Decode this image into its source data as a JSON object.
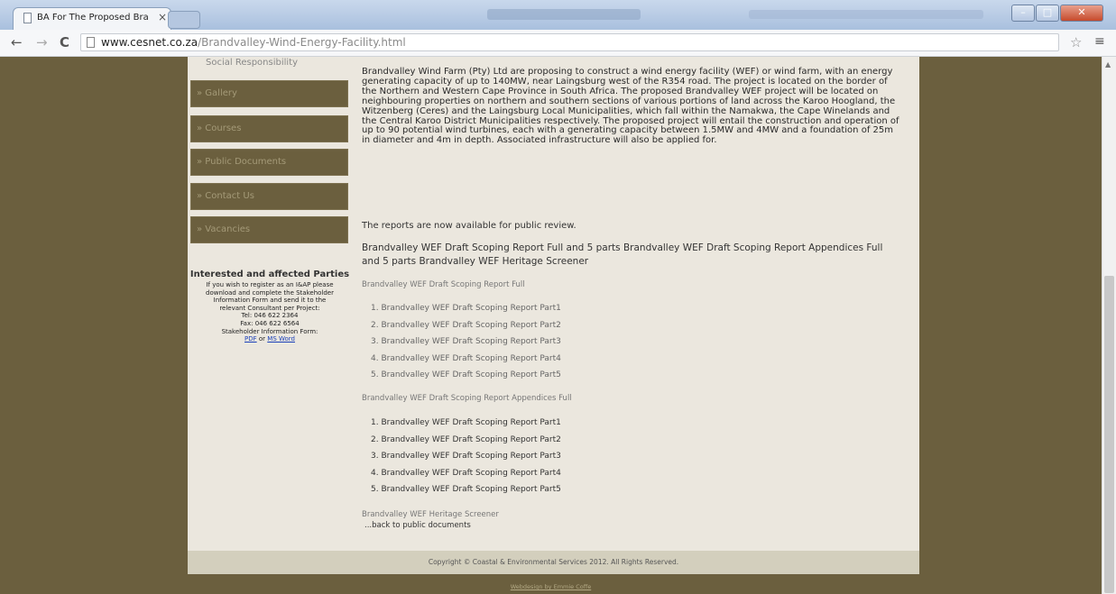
{
  "browser": {
    "tab_title": "BA For The Proposed Bra",
    "tab_close": "×",
    "url_host": "www.cesnet.co.za",
    "url_path": "/Brandvalley-Wind-Energy-Facility.html",
    "back": "←",
    "forward": "→",
    "reload": "C",
    "star": "☆",
    "menu": "≡"
  },
  "sidebar": {
    "top_label": "Social Responsibility",
    "items": [
      {
        "label": "» Gallery"
      },
      {
        "label": "» Courses"
      },
      {
        "label": "» Public Documents"
      },
      {
        "label": "» Contact Us"
      },
      {
        "label": "» Vacancies"
      }
    ],
    "iap": {
      "title": "Interested and affected Parties",
      "lines": [
        "If you wish to register as an I&AP please",
        "download and complete the Stakeholder",
        "Information Form and send it to the",
        "relevant Consultant per Project:",
        "Tel: 046 622 2364",
        "Fax: 046 622 6564",
        "Stakeholder Information Form:"
      ],
      "link_pdf": "PDF",
      "link_or": "or",
      "link_word": "MS Word"
    }
  },
  "content": {
    "intro": "Brandvalley Wind Farm (Pty) Ltd are proposing to construct a wind energy facility (WEF) or wind farm, with an energy generating capacity of up to 140MW, near Laingsburg west of the R354 road. The project is located on the border of the Northern and Western Cape Province in South Africa. The proposed Brandvalley WEF project will be located on neighbouring properties on northern and southern sections of various portions of land across the Karoo Hoogland, the Witzenberg (Ceres) and the Laingsburg Local Municipalities, which fall within the Namakwa, the Cape Winelands and the Central Karoo District Municipalities respectively. The proposed project will entail the construction and operation of up to 90 potential wind turbines, each with a generating capacity between 1.5MW and 4MW and a foundation of 25m in diameter and 4m in depth. Associated infrastructure will also be applied for.",
    "reports_available": "The reports are now available for public review.",
    "report_links": "Brandvalley WEF Draft Scoping Report Full and 5 parts Brandvalley WEF Draft Scoping Report Appendices Full and 5 parts Brandvalley WEF Heritage Screener",
    "section1": "Brandvalley WEF Draft Scoping Report Full",
    "list1": [
      "1. Brandvalley WEF Draft Scoping Report Part1",
      "2. Brandvalley WEF Draft Scoping Report Part2",
      "3. Brandvalley WEF Draft Scoping Report Part3",
      "4. Brandvalley WEF Draft Scoping Report Part4",
      "5. Brandvalley WEF Draft Scoping Report Part5"
    ],
    "section2": "Brandvalley WEF Draft Scoping Report Appendices Full",
    "list2": [
      "1. Brandvalley WEF Draft Scoping Report Part1",
      "2. Brandvalley WEF Draft Scoping Report Part2",
      "3. Brandvalley WEF Draft Scoping Report Part3",
      "4. Brandvalley WEF Draft Scoping Report Part4",
      "5. Brandvalley WEF Draft Scoping Report Part5"
    ],
    "section3": "Brandvalley WEF Heritage Screener",
    "back_link": "...back to public documents"
  },
  "footer": {
    "copyright": "Copyright © Coastal & Environmental Services 2012. All Rights Reserved.",
    "webdesign": "Webdesign by Emmie Coffe"
  }
}
